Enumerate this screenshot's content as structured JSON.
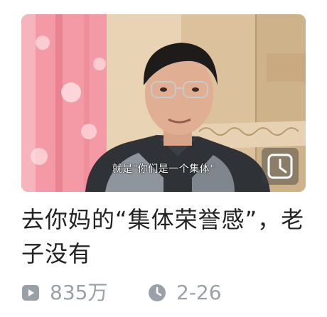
{
  "video": {
    "thumbnail_subtitle": "就是\"你们是一个集体\"",
    "title": "去你妈的“集体荣誉感”，老子没有",
    "play_count": "835万",
    "date": "2-26",
    "play_icon": "play-icon",
    "clock_icon": "clock-icon",
    "watch_later_icon": "watch-later-clock-icon"
  }
}
